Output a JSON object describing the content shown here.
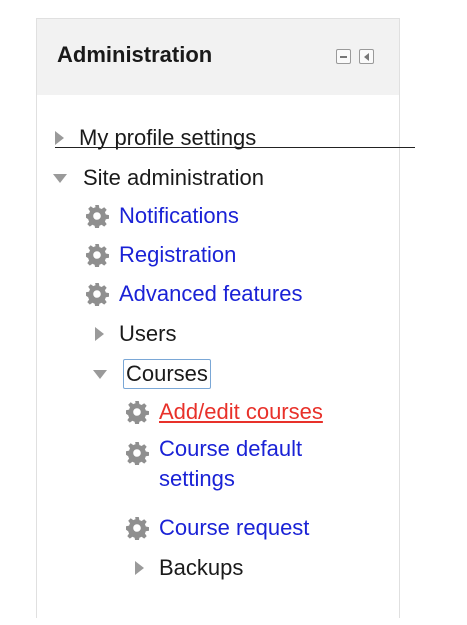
{
  "block": {
    "title": "Administration",
    "minimize_label": "Minimize block",
    "dock_label": "Dock block"
  },
  "tree": {
    "my_profile_settings": "My profile settings",
    "site_administration": "Site administration",
    "notifications": "Notifications",
    "registration": "Registration",
    "advanced_features": "Advanced features",
    "users": "Users",
    "courses": "Courses",
    "add_edit_courses": "Add/edit courses",
    "course_default_settings_line1": "Course default",
    "course_default_settings_line2": "settings",
    "course_request": "Course request",
    "backups": "Backups"
  },
  "colors": {
    "link": "#1a22d6",
    "active_link": "#e8312a",
    "header_bg": "#f2f2f2",
    "icon_gray": "#9a9a9a"
  }
}
